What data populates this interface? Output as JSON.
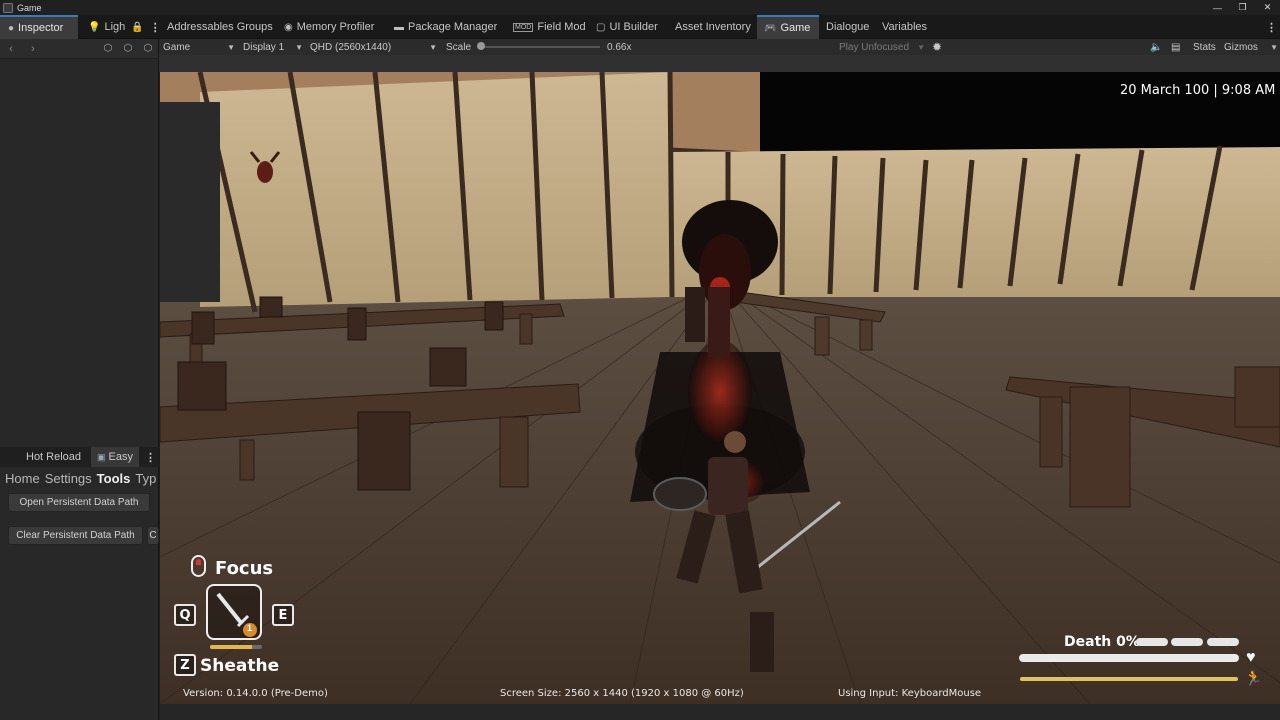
{
  "window": {
    "title": "Game",
    "controls": {
      "minimize": "—",
      "restore": "❐",
      "close": "✕"
    }
  },
  "tabs": {
    "inspector": "Inspector",
    "lighting": "Ligh",
    "addressables": "Addressables Groups",
    "memory_profiler": "Memory Profiler",
    "package_manager": "Package Manager",
    "field_mod": "Field Mod",
    "ui_builder": "UI Builder",
    "asset_inventory": "Asset Inventory",
    "game": "Game",
    "dialogue": "Dialogue",
    "variables": "Variables",
    "more": "⋮"
  },
  "left_panel": {
    "nav_back": "‹",
    "nav_forward": "›",
    "tabs": {
      "hot_reload": "Hot Reload",
      "easy": "Easy",
      "more": "⋮"
    },
    "menu": {
      "home": "Home",
      "settings": "Settings",
      "tools": "Tools",
      "types": "Typ"
    },
    "buttons": {
      "open_persistent": "Open Persistent Data Path",
      "clear_persistent": "Clear Persistent Data Path",
      "clipped": "C"
    }
  },
  "game_toolbar": {
    "view_mode": "Game",
    "display": "Display 1",
    "resolution": "QHD (2560x1440)",
    "scale_label": "Scale",
    "scale_value": "0.66x",
    "scale_level": 0.0,
    "play_mode": "Play Unfocused",
    "stats": "Stats",
    "gizmos": "Gizmos"
  },
  "hud": {
    "date_time": "20 March 100 | 9:08 AM",
    "focus_label": "Focus",
    "key_q": "Q",
    "key_e": "E",
    "key_z": "Z",
    "sheathe_label": "Sheathe",
    "weapon_count": "1",
    "weapon_durability": 0.8,
    "death_label": "Death 0%",
    "health": 1.0,
    "stamina": 1.0
  },
  "footer": {
    "version": "Version: 0.14.0.0 (Pre-Demo)",
    "screen_size": "Screen Size: 2560 x 1440 (1920 x 1080 @ 60Hz)",
    "input": "Using Input: KeyboardMouse"
  },
  "colors": {
    "accent": "#3a79bb",
    "stamina": "#e0c35a",
    "weapon_bar": "#e3b84a",
    "floor": "#4a3a2e",
    "wall": "#c9b58f",
    "ember": "#e0301e"
  }
}
